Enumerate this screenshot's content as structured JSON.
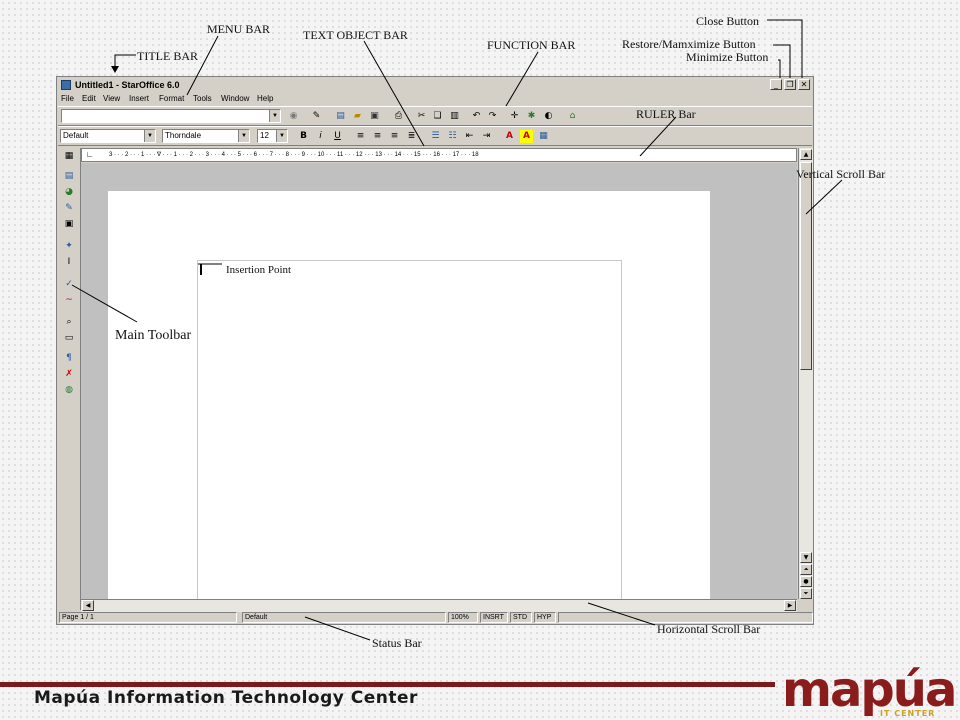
{
  "window": {
    "title": "Untitled1 - StarOffice 6.0",
    "menu": [
      "File",
      "Edit",
      "View",
      "Insert",
      "Format",
      "Tools",
      "Window",
      "Help"
    ],
    "paragraph_style": "Default",
    "font_name": "Thorndale",
    "font_size": "12",
    "ruler_marks": "3 · · · 2 · · · 1 · · · ∇ · · · 1 · · · 2 · · · 3 · · · 4 · · · 5 · · · 6 · · · 7 · · · 8 · · · 9 · · · 10 · · · 11 · · · 12 · · · 13 · · · 14 · · · 15 · · · 16 · · · 17 · · · 18",
    "status": {
      "page": "Page 1 / 1",
      "style": "Default",
      "zoom": "100%",
      "mode": "INSRT",
      "selection": "STD",
      "hyperlink": "HYP"
    }
  },
  "annotations": {
    "menu_bar": "MENU BAR",
    "text_object_bar": "TEXT OBJECT BAR",
    "function_bar": "FUNCTION BAR",
    "title_bar": "TITLE BAR",
    "close_button": "Close Button",
    "restore_button": "Restore/Mamximize Button",
    "minimize_button": "Minimize Button",
    "ruler_bar": "RULER Bar",
    "vertical_scroll_bar": "Vertical Scroll Bar",
    "insertion_point": "Insertion Point",
    "main_toolbar": "Main Toolbar",
    "horizontal_scroll_bar": "Horizontal Scroll Bar",
    "status_bar": "Status Bar"
  },
  "footer": {
    "org": "Mapúa Information Technology Center",
    "logo": "mapúa",
    "logo_sub": "IT CENTER"
  },
  "colors": {
    "footer_accent": "#7a1a1a",
    "logo": "#8a1c1c",
    "title_icon": "#3a6ea5"
  }
}
